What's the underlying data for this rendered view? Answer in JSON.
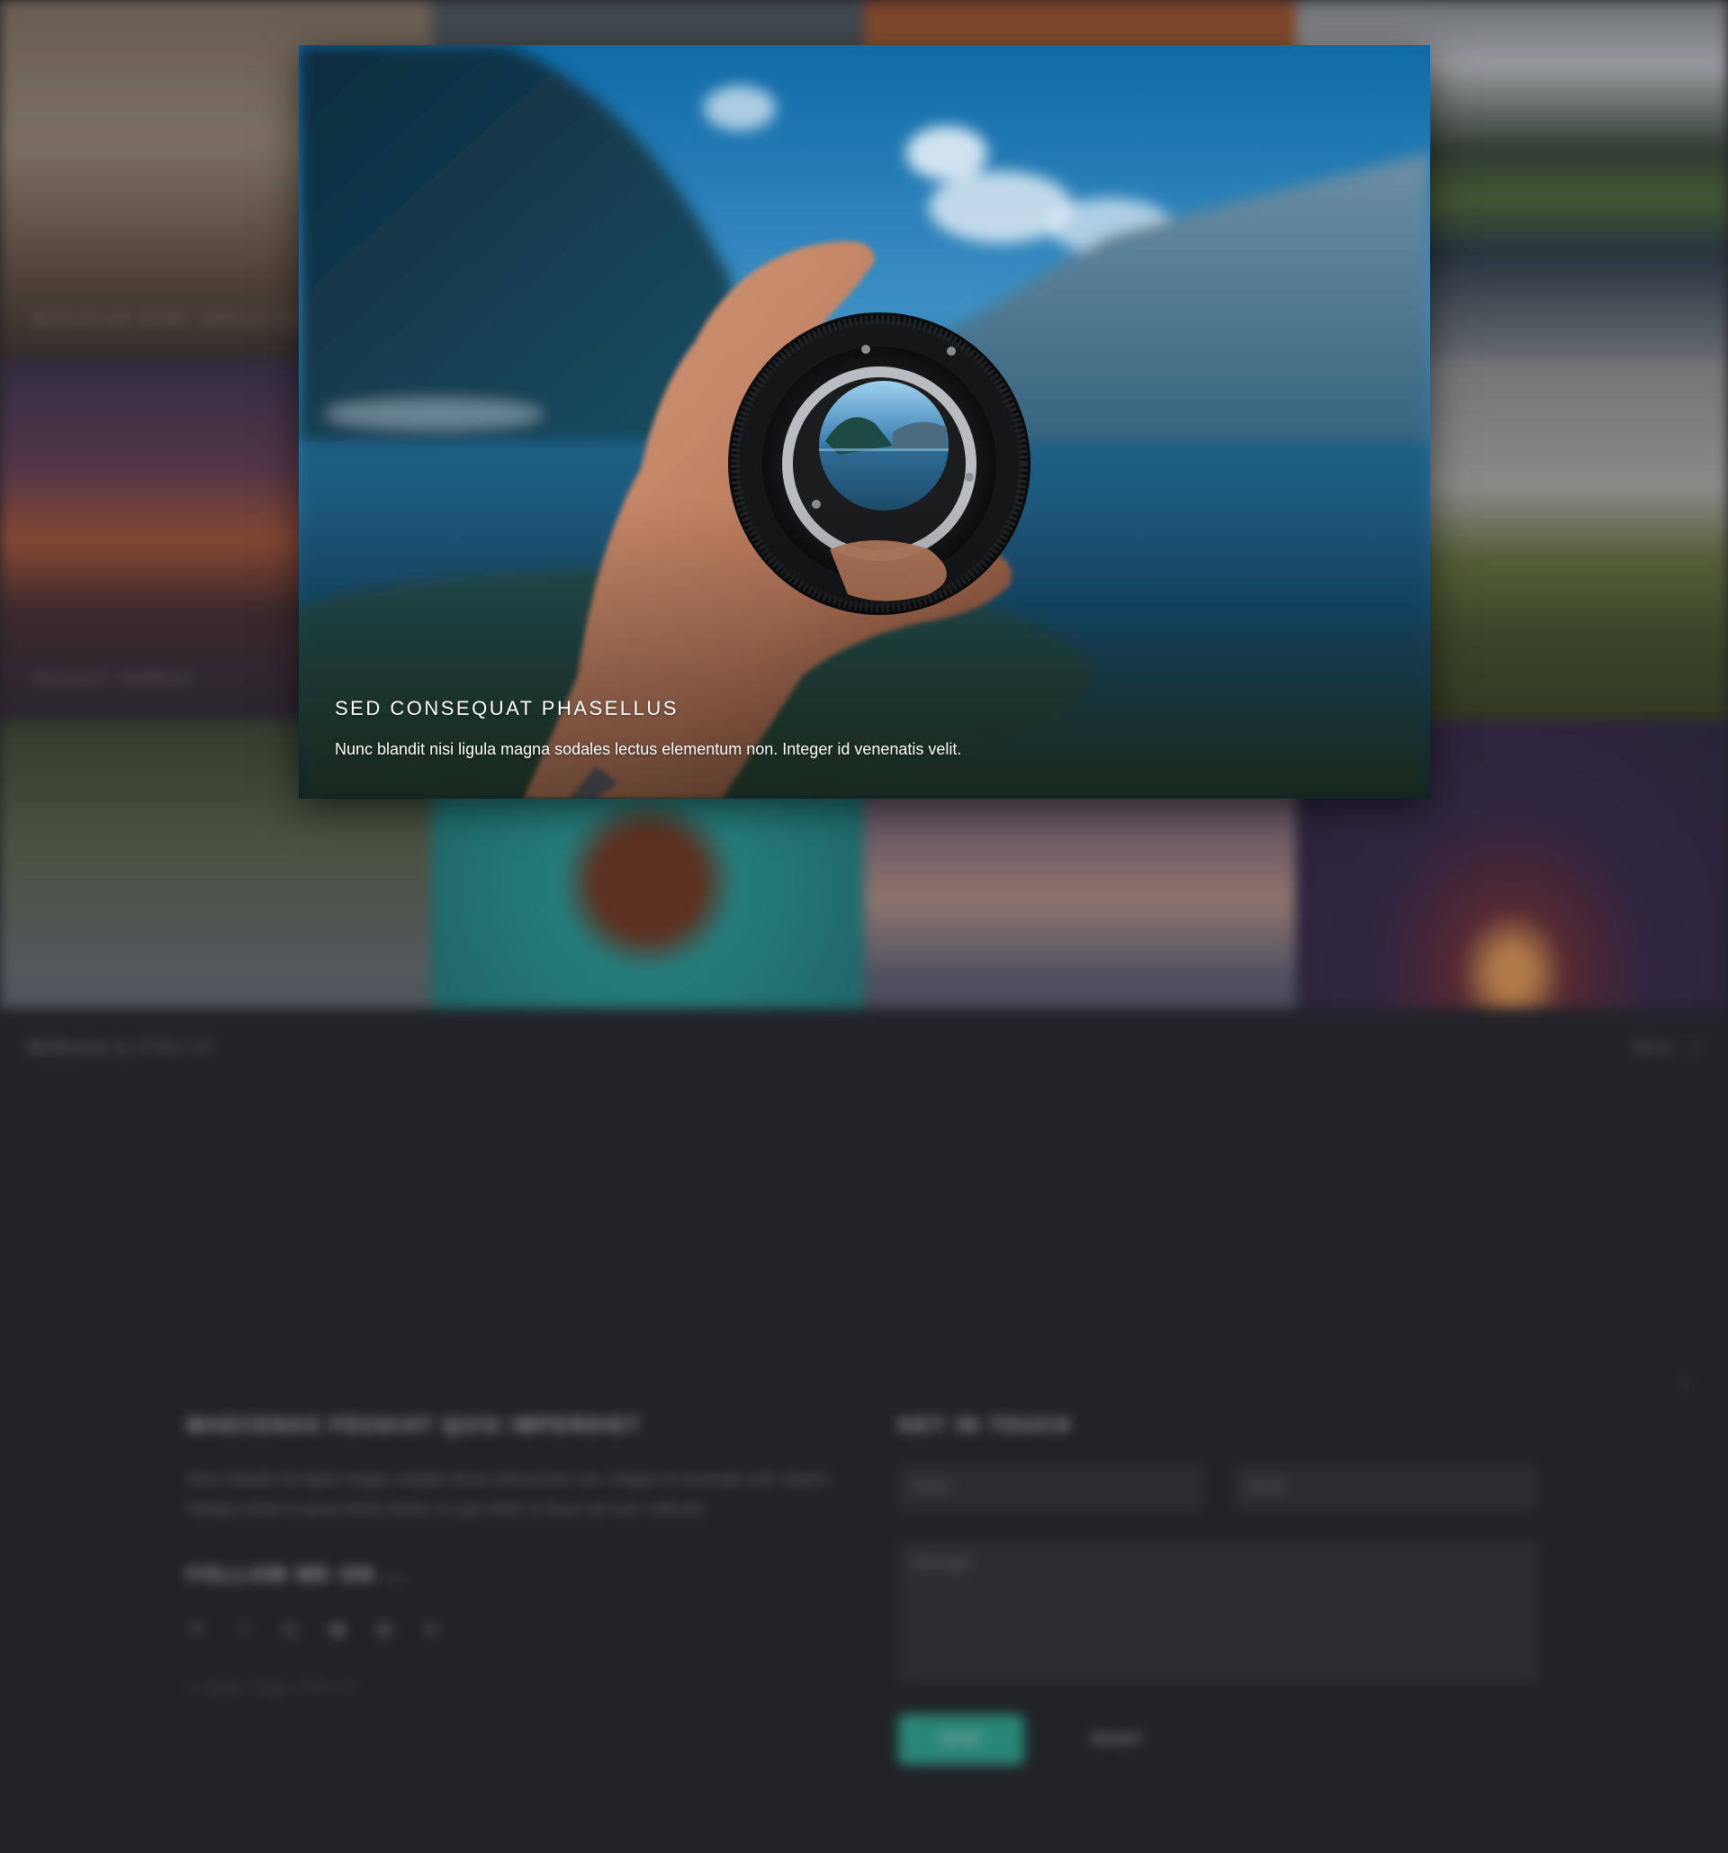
{
  "gallery": {
    "items": [
      {
        "title": "Nascetur nunc varius commodo",
        "palette": "warm-city"
      },
      {
        "title": "",
        "palette": "grey-blue"
      },
      {
        "title": "",
        "palette": "orange"
      },
      {
        "title": "",
        "palette": "alpine"
      },
      {
        "title": "Feugiat tempus",
        "palette": "sunset"
      },
      {
        "title": "",
        "palette": "lake"
      },
      {
        "title": "",
        "palette": "lake"
      },
      {
        "title": "",
        "palette": "rail"
      },
      {
        "title": "",
        "palette": "forest"
      },
      {
        "title": "",
        "palette": "turtle"
      },
      {
        "title": "",
        "palette": "dusk-sea"
      },
      {
        "title": "",
        "palette": "purple-fire"
      }
    ]
  },
  "header_bar": {
    "brand_strong": "Multiverse",
    "brand_rest": "by HTML5 UP",
    "about_label": "About",
    "close_glyph": "×"
  },
  "footer": {
    "close_glyph": "×",
    "about_heading": "Maecenas feugiat quis imperdiet",
    "about_text": "Nunc blandit nisi ligula magna sodales lectus elementum non. Integer id venenatis velit. Mauris tristique lorem in purus lectus donec eu quis dolor ut lacus vel nunc vehicula.",
    "follow_heading": "Follow me on ...",
    "social_icons": [
      "twitter-icon",
      "facebook-icon",
      "instagram-icon",
      "github-icon",
      "dribbble-icon",
      "linkedin-icon"
    ],
    "social_glyphs": [
      "✕",
      "f",
      "◎",
      "◉",
      "◍",
      "in"
    ],
    "copyright": "© Untitled. Design: HTML5 UP",
    "contact_heading": "Get in touch",
    "name_placeholder": "Name",
    "email_placeholder": "Email",
    "message_placeholder": "Message",
    "send_label": "Send",
    "reset_label": "Reset"
  },
  "lightbox": {
    "title": "SED CONSEQUAT PHASELLUS",
    "text": "Nunc blandit nisi ligula magna sodales lectus elementum non. Integer id venenatis velit."
  },
  "colors": {
    "background": "#242529",
    "accent": "#2fb59b"
  }
}
